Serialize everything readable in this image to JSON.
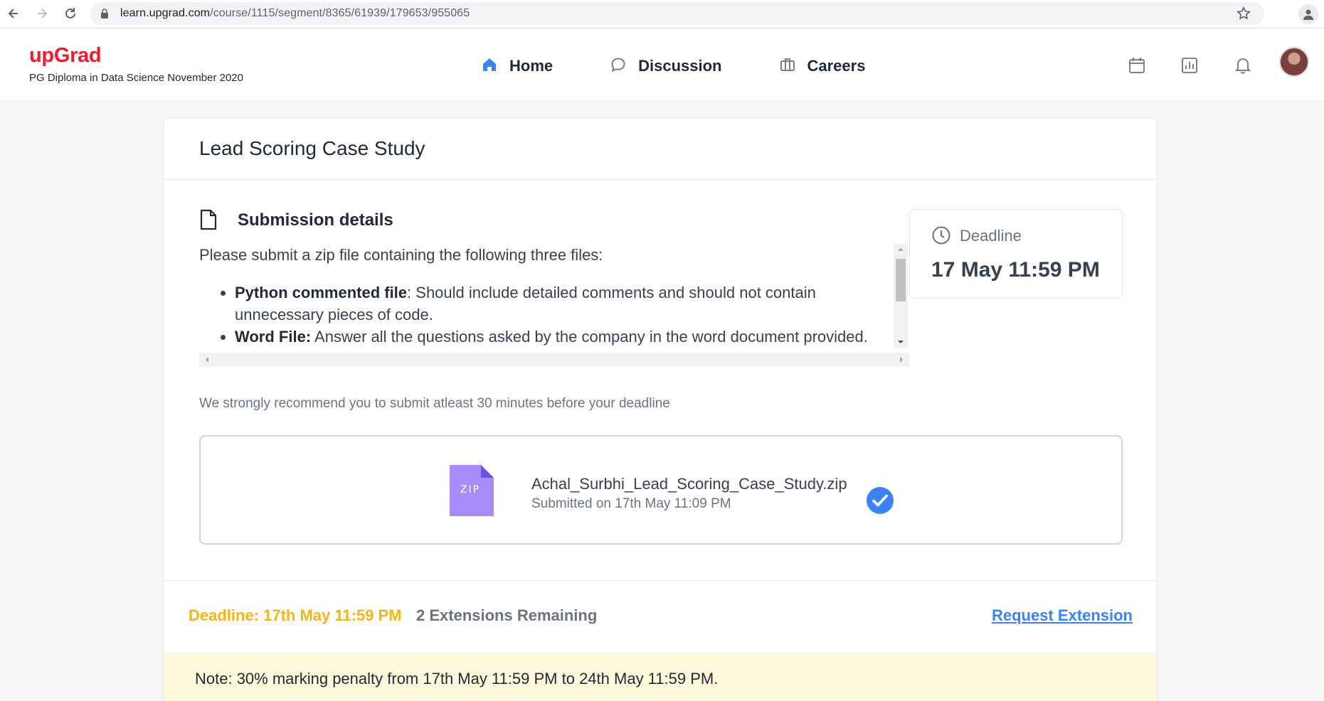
{
  "browser": {
    "url_host": "learn.upgrad.com",
    "url_path": "/course/1115/segment/8365/61939/179653/955065"
  },
  "header": {
    "logo": "upGrad",
    "program": "PG Diploma in Data Science November 2020",
    "nav": [
      {
        "label": "Home",
        "icon": "home-icon"
      },
      {
        "label": "Discussion",
        "icon": "chat-bubble-icon"
      },
      {
        "label": "Careers",
        "icon": "briefcase-icon"
      }
    ],
    "icons": [
      "calendar-icon",
      "bar-chart-icon",
      "bell-icon",
      "avatar"
    ]
  },
  "assignment": {
    "title": "Lead Scoring Case Study",
    "submission_heading": "Submission details",
    "intro": "Please submit a zip file containing the following three files:",
    "items": [
      {
        "bold": "Python commented file",
        "text": ": Should include detailed comments and should not contain unnecessary pieces of code."
      },
      {
        "bold": "Word File:",
        "text": " Answer all the questions asked by the company in the word document provided."
      }
    ],
    "deadline_label": "Deadline",
    "deadline_value": "17 May 11:59 PM",
    "recommend": "We strongly recommend you to submit atleast 30 minutes before your deadline",
    "file": {
      "badge": "ZIP",
      "name": "Achal_Surbhi_Lead_Scoring_Case_Study.zip",
      "submitted": "Submitted on 17th May 11:09 PM"
    },
    "footer": {
      "deadline": "Deadline: 17th May 11:59 PM",
      "extensions": "2 Extensions Remaining",
      "request": "Request Extension"
    },
    "note": "Note: 30% marking penalty from 17th May 11:59 PM to 24th May 11:59 PM."
  },
  "colors": {
    "brand": "#e8202e",
    "deadline_yellow": "#f5b319",
    "link_blue": "#3b82f6",
    "zip_purple": "#a78bfa",
    "note_bg": "#fdf8d9"
  }
}
